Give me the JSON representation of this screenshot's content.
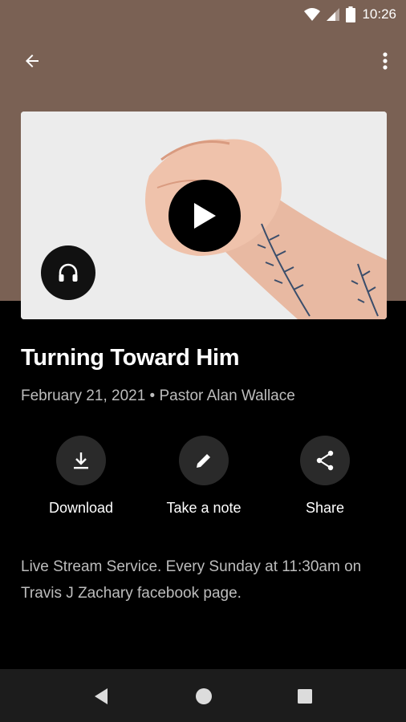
{
  "status_bar": {
    "time": "10:26",
    "icons": [
      "wifi-icon",
      "signal-icon",
      "battery-icon"
    ]
  },
  "app_bar": {
    "back_icon": "arrow-back-icon",
    "more_icon": "more-vert-icon"
  },
  "colors": {
    "header_bg": "#7a6154",
    "page_bg": "#000000",
    "action_circle": "#2a2a2a",
    "secondary_text": "#bdbdbd",
    "nav_bar_bg": "#1c1c1c"
  },
  "media": {
    "play_icon": "play-icon",
    "audio_icon": "headphones-icon"
  },
  "sermon": {
    "title": "Turning Toward Him",
    "meta": "February 21, 2021 • Pastor Alan Wallace",
    "description": "Live Stream Service.  Every Sunday at 11:30am on Travis J Zachary facebook page."
  },
  "actions": [
    {
      "label": "Download",
      "icon": "download-icon"
    },
    {
      "label": "Take a note",
      "icon": "pencil-icon"
    },
    {
      "label": "Share",
      "icon": "share-icon"
    }
  ],
  "nav": {
    "back": "nav-back-icon",
    "home": "nav-home-icon",
    "recents": "nav-recents-icon"
  }
}
